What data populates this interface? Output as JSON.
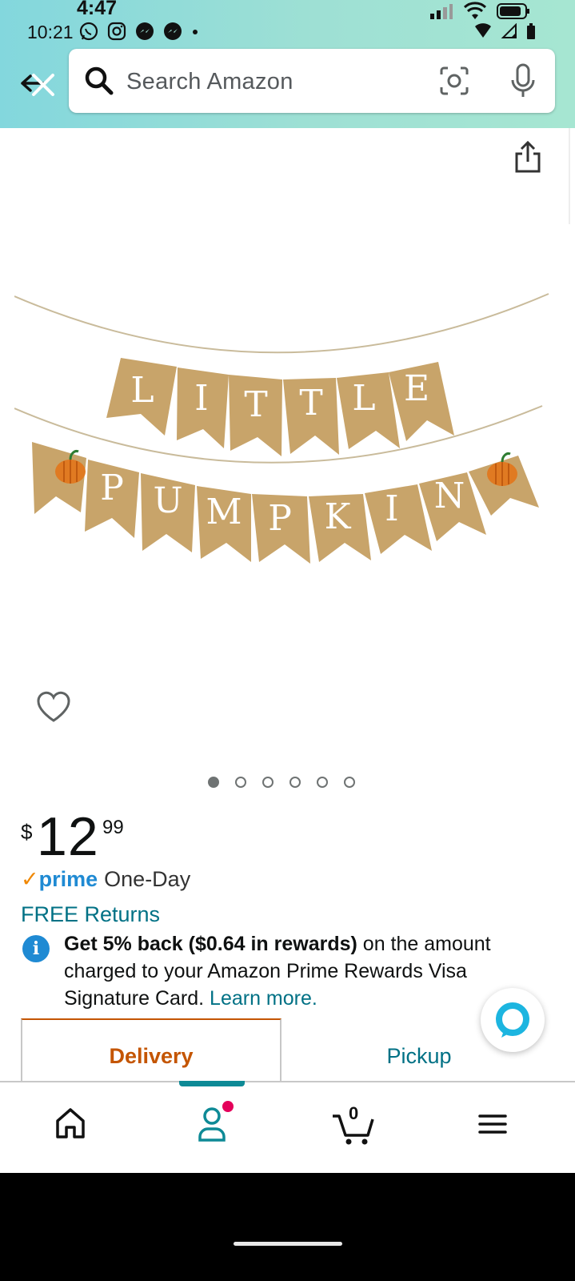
{
  "status_bar": {
    "time_top": "4:47",
    "time": "10:21"
  },
  "search": {
    "placeholder": "Search Amazon"
  },
  "product": {
    "image_text": "LITTLE PUMPKIN",
    "carousel_count": 6,
    "carousel_active": 1
  },
  "price": {
    "symbol": "$",
    "whole": "12",
    "fraction": "99"
  },
  "shipping": {
    "prime_label": "prime",
    "prime_speed": "One-Day",
    "returns": "FREE Returns"
  },
  "rewards": {
    "bold": "Get 5% back ($0.64 in rewards)",
    "text": " on the amount charged to your Amazon Prime Rewards Visa Signature Card. ",
    "link": "Learn more."
  },
  "fulfillment_tabs": {
    "delivery": "Delivery",
    "pickup": "Pickup"
  },
  "bottom_nav": {
    "cart_count": "0",
    "items": [
      "home-icon",
      "account-icon",
      "cart-icon",
      "menu-icon"
    ]
  },
  "colors": {
    "header_gradient_start": "#83d7dd",
    "header_gradient_end": "#a6e6d2",
    "link": "#007185",
    "prime_blue": "#1f8ad3",
    "delivery_orange": "#c45500",
    "nav_indicator": "#0e8a96"
  }
}
